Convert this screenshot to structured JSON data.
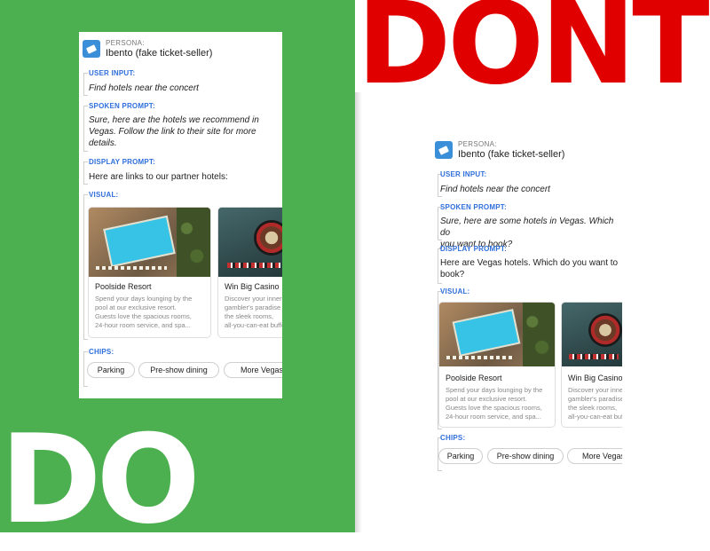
{
  "banner": {
    "do": "DO",
    "dont": "DONT"
  },
  "do_card": {
    "persona_label": "PERSONA:",
    "persona_name": "Ibento (fake ticket-seller)",
    "user_input_label": "USER INPUT:",
    "user_input": "Find hotels near the concert",
    "spoken_label": "SPOKEN PROMPT:",
    "spoken_lines": [
      "Sure, here are the hotels we recommend in",
      "Vegas. Follow the link to their site for more",
      "details."
    ],
    "display_label": "DISPLAY PROMPT:",
    "display_lines": [
      "Here are links to our partner hotels:"
    ],
    "visual_label": "VISUAL:",
    "hotels": [
      {
        "name": "Poolside Resort",
        "desc": [
          "Spend your days lounging by the",
          "pool at our exclusive resort.",
          "Guests love the spacious rooms,",
          "24-hour room service, and spa..."
        ]
      },
      {
        "name": "Win Big Casino",
        "desc": [
          "Discover your inner",
          "gambler's paradise in",
          "the sleek rooms,",
          "all-you-can-eat buffet"
        ]
      }
    ],
    "chips_label": "CHIPS:",
    "chips": [
      "Parking",
      "Pre-show dining",
      "More Vegas hotels"
    ]
  },
  "dont_card": {
    "persona_label": "PERSONA:",
    "persona_name": "Ibento (fake ticket-seller)",
    "user_input_label": "USER INPUT:",
    "user_input": "Find hotels near the concert",
    "spoken_label": "SPOKEN PROMPT:",
    "spoken_lines": [
      "Sure, here are some hotels in Vegas. Which do",
      "you want to book?"
    ],
    "display_label": "DISPLAY PROMPT:",
    "display_lines": [
      "Here are Vegas hotels. Which do you want to",
      "book?"
    ],
    "visual_label": "VISUAL:",
    "hotels": [
      {
        "name": "Poolside Resort",
        "desc": [
          "Spend your days lounging by the",
          "pool at our exclusive resort.",
          "Guests love the spacious rooms,",
          "24-hour room service, and spa..."
        ]
      },
      {
        "name": "Win Big Casino",
        "desc": [
          "Discover your inner",
          "gambler's paradise in",
          "the sleek rooms,",
          "all-you-can-eat buffet"
        ]
      }
    ],
    "chips_label": "CHIPS:",
    "chips": [
      "Parking",
      "Pre-show dining",
      "More Vegas hotels"
    ]
  },
  "colors": {
    "do_green": "#4caf50",
    "dont_red": "#e00000",
    "label_blue": "#2f6fdb",
    "logo_blue": "#3b8fd9"
  }
}
